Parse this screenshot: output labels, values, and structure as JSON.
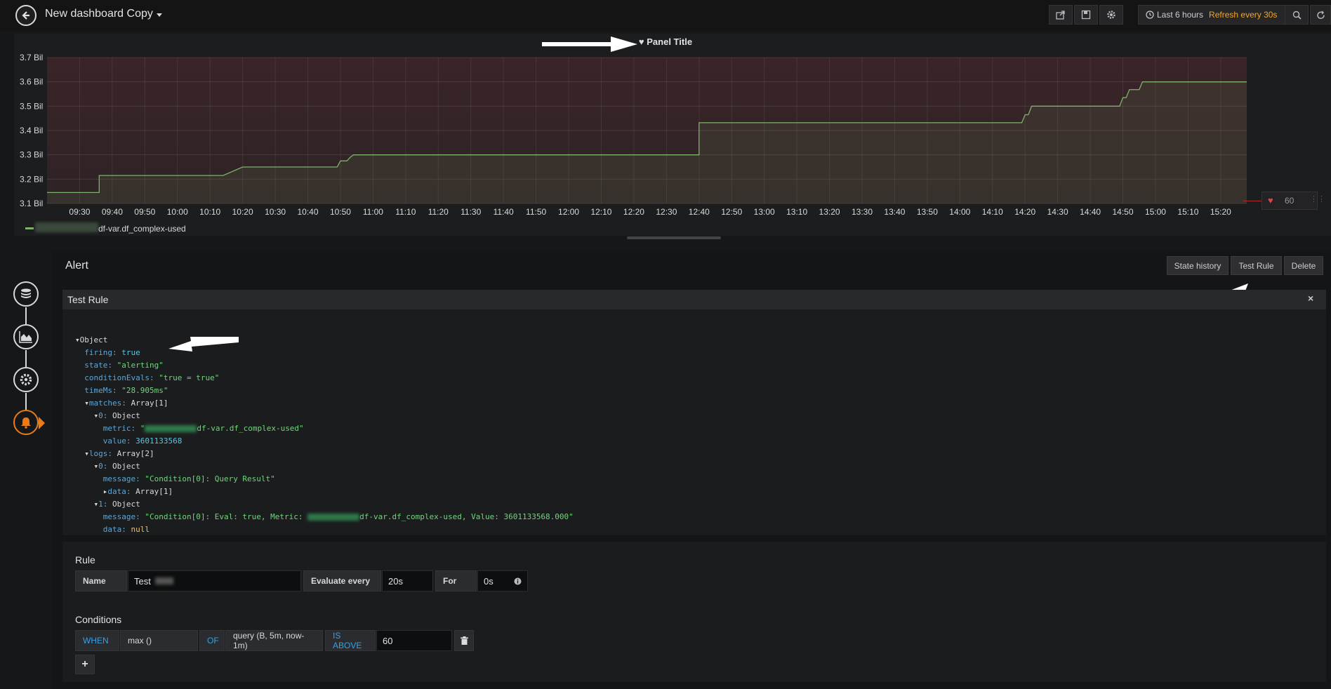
{
  "topbar": {
    "title": "New dashboard Copy",
    "time_range": "Last 6 hours",
    "refresh": "Refresh every 30s",
    "icons": [
      "back-arrow-icon",
      "share-icon",
      "save-icon",
      "gear-icon",
      "clock-icon",
      "zoom-out-icon",
      "refresh-icon"
    ]
  },
  "panel": {
    "title": "Panel Title",
    "legend_label": "df-var.df_complex-used",
    "threshold_value": "60"
  },
  "chart_data": {
    "type": "line",
    "y_ticks": [
      "3.7 Bil",
      "3.6 Bil",
      "3.5 Bil",
      "3.4 Bil",
      "3.3 Bil",
      "3.2 Bil",
      "3.1 Bil"
    ],
    "x_ticks": [
      "09:30",
      "09:40",
      "09:50",
      "10:00",
      "10:10",
      "10:20",
      "10:30",
      "10:40",
      "10:50",
      "11:00",
      "11:10",
      "11:20",
      "11:30",
      "11:40",
      "11:50",
      "12:00",
      "12:10",
      "12:20",
      "12:30",
      "12:40",
      "12:50",
      "13:00",
      "13:10",
      "13:20",
      "13:30",
      "13:40",
      "13:50",
      "14:00",
      "14:10",
      "14:20",
      "14:30",
      "14:40",
      "14:50",
      "15:00",
      "15:10",
      "15:20"
    ],
    "ylim": [
      3.1,
      3.7
    ],
    "series": [
      {
        "color": "#7eb26d",
        "points": [
          [
            "09:20",
            3.145
          ],
          [
            "09:36",
            3.145
          ],
          [
            "09:36",
            3.215
          ],
          [
            "10:14",
            3.215
          ],
          [
            "10:20",
            3.25
          ],
          [
            "10:49",
            3.25
          ],
          [
            "10:50",
            3.275
          ],
          [
            "10:52",
            3.275
          ],
          [
            "10:53",
            3.29
          ],
          [
            "10:54",
            3.3
          ],
          [
            "12:40",
            3.3
          ],
          [
            "12:40",
            3.432
          ],
          [
            "14:19",
            3.432
          ],
          [
            "14:20",
            3.465
          ],
          [
            "14:21",
            3.465
          ],
          [
            "14:22",
            3.5
          ],
          [
            "14:49",
            3.5
          ],
          [
            "14:50",
            3.535
          ],
          [
            "14:51",
            3.535
          ],
          [
            "14:52",
            3.568
          ],
          [
            "14:55",
            3.568
          ],
          [
            "14:56",
            3.6
          ],
          [
            "15:28",
            3.6
          ]
        ]
      }
    ],
    "alert_region": "above threshold (red fill)"
  },
  "sidebar_steps": [
    {
      "name": "queries",
      "icon": "database-icon"
    },
    {
      "name": "visualization",
      "icon": "chart-icon"
    },
    {
      "name": "general",
      "icon": "gear-icon"
    },
    {
      "name": "alert",
      "icon": "bell-icon"
    }
  ],
  "alert": {
    "title": "Alert",
    "state_history": "State history",
    "test_rule": "Test Rule",
    "delete": "Delete"
  },
  "test_rule": {
    "title": "Test Rule",
    "close": "×",
    "lines": {
      "object": "Object",
      "firing_k": "firing:",
      "firing_v": "true",
      "state_k": "state:",
      "state_v": "\"alerting\"",
      "cond_k": "conditionEvals:",
      "cond_v": "\"true = true\"",
      "time_k": "timeMs:",
      "time_v": "\"28.905ms\"",
      "matches_k": "matches:",
      "matches_v": "Array[1]",
      "m0_k": "0:",
      "m0_v": "Object",
      "metric_k": "metric:",
      "metric_open": "\"",
      "metric_v": "df-var.df_complex-used\"",
      "value_k": "value:",
      "value_v": "3601133568",
      "logs_k": "logs:",
      "logs_v": "Array[2]",
      "l0_k": "0:",
      "l0_v": "Object",
      "msg0_k": "message:",
      "msg0_v": "\"Condition[0]: Query Result\"",
      "data0_k": "data:",
      "data0_v": "Array[1]",
      "l1_k": "1:",
      "l1_v": "Object",
      "msg1_k": "message:",
      "msg1_a": "\"Condition[0]: Eval: true, Metric:",
      "msg1_b": "df-var.df_complex-used, Value: 3601133568.000\"",
      "data1_k": "data:",
      "data1_v": "null"
    }
  },
  "rule": {
    "section": "Rule",
    "name_label": "Name",
    "name_value": "Test",
    "evaluate_label": "Evaluate every",
    "evaluate_value": "20s",
    "for_label": "For",
    "for_value": "0s"
  },
  "conditions": {
    "section": "Conditions",
    "when": "WHEN",
    "reducer": "max ()",
    "of": "OF",
    "query": "query (B, 5m, now-1m)",
    "evaluator": "IS ABOVE",
    "threshold": "60",
    "add": "+"
  }
}
